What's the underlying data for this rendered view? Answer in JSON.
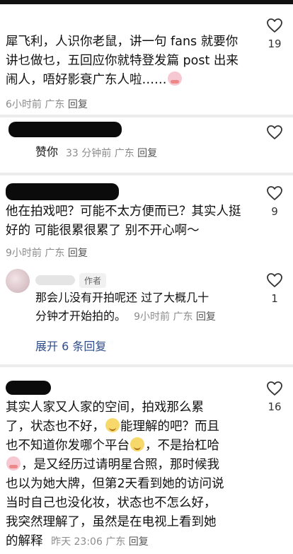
{
  "comments": [
    {
      "text": "犀飞利，人识你老鼠，讲一句 fans 就要你讲乜做乜，五回应你就特登发篇 post 出来闹人，唔好影衰广东人啦……",
      "emoji": "crying-face",
      "time": "6小时前",
      "location": "广东",
      "reply": "回复",
      "likes": "19"
    },
    {
      "text": "赞你",
      "time": "33 分钟前",
      "location": "广东",
      "reply": "回复",
      "likes": ""
    },
    {
      "text": "他在拍戏吧？可能不太方便而已？其实人挺好的 可能很累很累了 别不开心啊～",
      "time": "9小时前",
      "location": "广东",
      "reply": "回复",
      "likes": "9"
    },
    {
      "badge": "作者",
      "text_line1": "那会儿没有开拍呢还 过了大概几十",
      "text_line2": "分钟才开始拍的。",
      "time": "9小时前",
      "location": "广东",
      "reply": "回复",
      "likes": "1",
      "expand": "展开 6 条回复"
    },
    {
      "line1": "其实人家又人家的空间，拍戏那么累",
      "line2a": "了，状态也不好，",
      "line2b": "能理解的吧？而且",
      "line3a": "也不知道你发哪个平台",
      "line3b": "，不是抬杠哈",
      "line4": "，是又经历过请明星合照，那时候我",
      "line5": "也以为她大牌，但第2天看到她的访问说",
      "line6": "当时自己也没化妆，状态也不怎么好，",
      "line7": "我突然理解了，虽然是在电视上看到她",
      "line8": "的解释",
      "time": "昨天 23:06",
      "location": "广东",
      "reply": "回复",
      "likes": "16"
    }
  ]
}
